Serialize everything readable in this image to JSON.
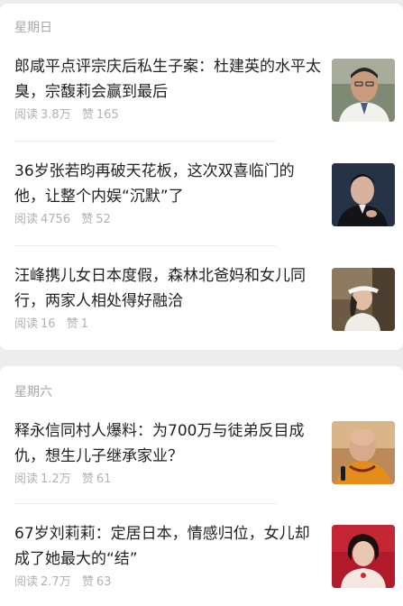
{
  "groups": [
    {
      "day": "星期日",
      "articles": [
        {
          "title": "郎咸平点评宗庆后私生子案：杜建英的水平太臭，宗馥莉会赢到最后",
          "reads_label": "阅读",
          "reads": "3.8万",
          "likes_label": "赞",
          "likes": "165",
          "thumb_icon": "older-man-portrait"
        },
        {
          "title": "36岁张若昀再破天花板，这次双喜临门的他，让整个内娱“沉默”了",
          "reads_label": "阅读",
          "reads": "4756",
          "likes_label": "赞",
          "likes": "52",
          "thumb_icon": "young-man-portrait"
        },
        {
          "title": "汪峰携儿女日本度假，森林北爸妈和女儿同行，两家人相处得好融洽",
          "reads_label": "阅读",
          "reads": "16",
          "likes_label": "赞",
          "likes": "1",
          "thumb_icon": "woman-visor-portrait"
        }
      ]
    },
    {
      "day": "星期六",
      "articles": [
        {
          "title": "释永信同村人爆料：为700万与徒弟反目成仇，想生儿子继承家业？",
          "reads_label": "阅读",
          "reads": "1.2万",
          "likes_label": "赞",
          "likes": "61",
          "thumb_icon": "monk-portrait"
        },
        {
          "title": "67岁刘莉莉：定居日本，情感归位，女儿却成了她最大的“结”",
          "reads_label": "阅读",
          "reads": "2.7万",
          "likes_label": "赞",
          "likes": "63",
          "thumb_icon": "woman-red-portrait"
        }
      ]
    }
  ]
}
